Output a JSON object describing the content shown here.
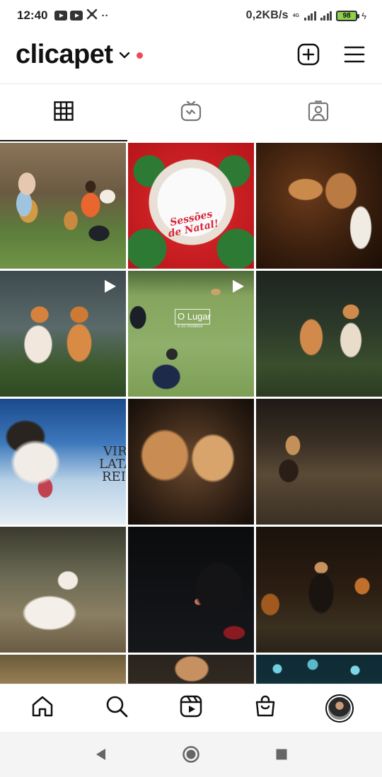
{
  "status_bar": {
    "time": "12:40",
    "speed": "0,2KB/s",
    "network": "4G",
    "battery": "98",
    "left_icons": [
      "youtube-icon",
      "youtube-icon",
      "bug-icon",
      "more-dots-icon"
    ]
  },
  "header": {
    "username": "clicapet",
    "has_notification_dot": true,
    "actions": [
      "new-post-icon",
      "menu-icon"
    ]
  },
  "tabs": [
    {
      "name": "tab-grid",
      "icon": "grid-icon",
      "active": true
    },
    {
      "name": "tab-igtv",
      "icon": "igtv-icon",
      "active": false
    },
    {
      "name": "tab-tagged",
      "icon": "tagged-icon",
      "active": false
    }
  ],
  "posts": [
    {
      "desc": "family-with-dogs",
      "video": false
    },
    {
      "desc": "christmas-pomeranian",
      "video": false,
      "caption": "Sessões de Natal!"
    },
    {
      "desc": "greyhound-portrait",
      "video": false
    },
    {
      "desc": "two-pomeranians",
      "video": true
    },
    {
      "desc": "photographer-location",
      "video": true,
      "caption": "O Lugar",
      "subcaption": "e os modelos"
    },
    {
      "desc": "two-pomeranians-dark",
      "video": false
    },
    {
      "desc": "dog-tongue-out",
      "video": false,
      "caption_lines": [
        "VIRA",
        "LATA",
        "REI"
      ]
    },
    {
      "desc": "pomeranians-closeup",
      "video": false
    },
    {
      "desc": "dachshund-grass",
      "video": false
    },
    {
      "desc": "white-pomeranian",
      "video": false
    },
    {
      "desc": "black-dog",
      "video": false
    },
    {
      "desc": "black-pomeranian",
      "video": false
    },
    {
      "desc": "partial-1",
      "video": false
    },
    {
      "desc": "partial-2",
      "video": false
    },
    {
      "desc": "partial-3",
      "video": false
    }
  ],
  "bottom_nav": [
    "home-icon",
    "search-icon",
    "reels-icon",
    "shop-icon",
    "profile-avatar"
  ],
  "system_nav": [
    "back-button",
    "home-button",
    "recents-button"
  ],
  "colors": {
    "notification": "#ed4956",
    "battery": "#8fd14f"
  }
}
